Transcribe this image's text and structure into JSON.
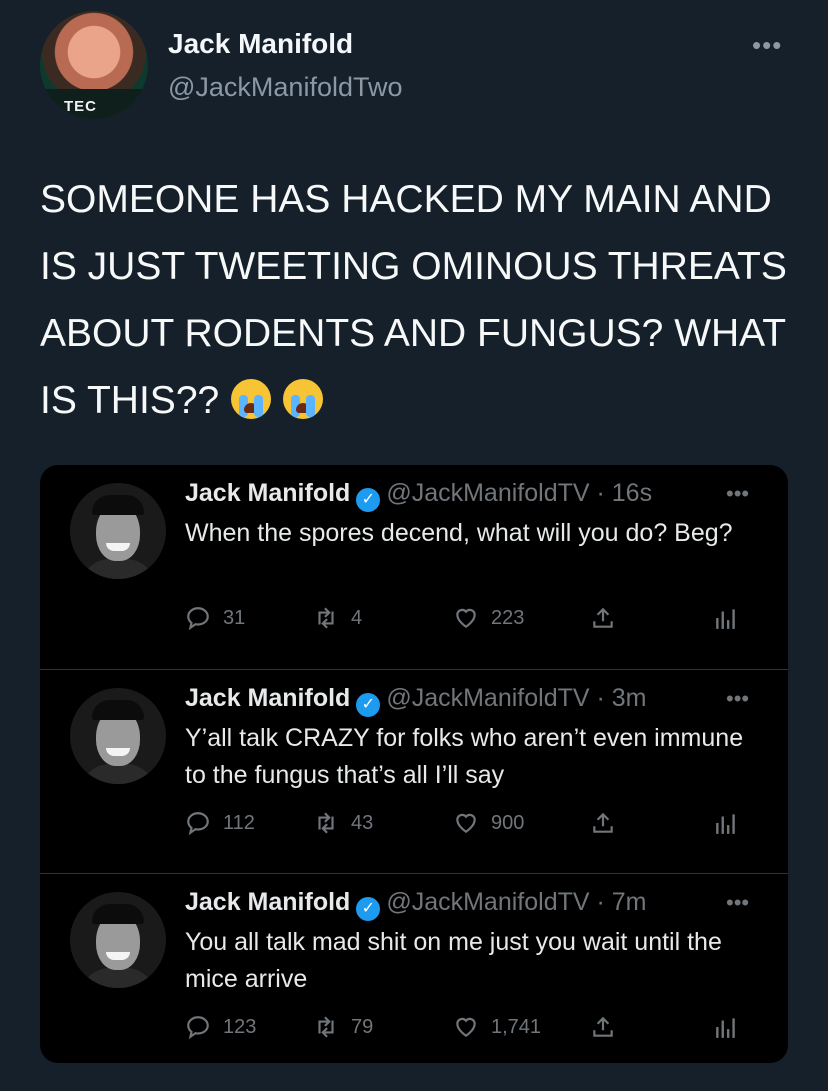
{
  "main_tweet": {
    "author_name": "Jack Manifold",
    "author_handle": "@JackManifoldTwo",
    "avatar_shirt_text": "TEC",
    "more_label": "•••",
    "text": "SOMEONE HAS HACKED MY MAIN AND IS JUST TWEETING OMINOUS THREATS ABOUT RODENTS AND FUNGUS? WHAT IS THIS??",
    "emojis": [
      "loudly-crying-face",
      "loudly-crying-face"
    ]
  },
  "embedded_tweets": [
    {
      "name": "Jack Manifold",
      "handle_time": "@JackManifoldTV · 16s",
      "text": "When the spores decend, what will you do? Beg?",
      "replies": "31",
      "retweets": "4",
      "likes": "223"
    },
    {
      "name": "Jack Manifold",
      "handle_time": "@JackManifoldTV · 3m",
      "text": "Y’all talk CRAZY for folks who aren’t even immune to the fungus that’s all I’ll say",
      "replies": "112",
      "retweets": "43",
      "likes": "900"
    },
    {
      "name": "Jack Manifold",
      "handle_time": "@JackManifoldTV · 7m",
      "text": "You all talk mad shit on me just you wait until the mice arrive",
      "replies": "123",
      "retweets": "79",
      "likes": "1,741"
    }
  ],
  "ui": {
    "more_label": "•••",
    "verified_glyph": "✓"
  },
  "colors": {
    "background": "#15202b",
    "embed_background": "#000000",
    "verified": "#1d9bf0",
    "secondary_text": "#71767b"
  }
}
